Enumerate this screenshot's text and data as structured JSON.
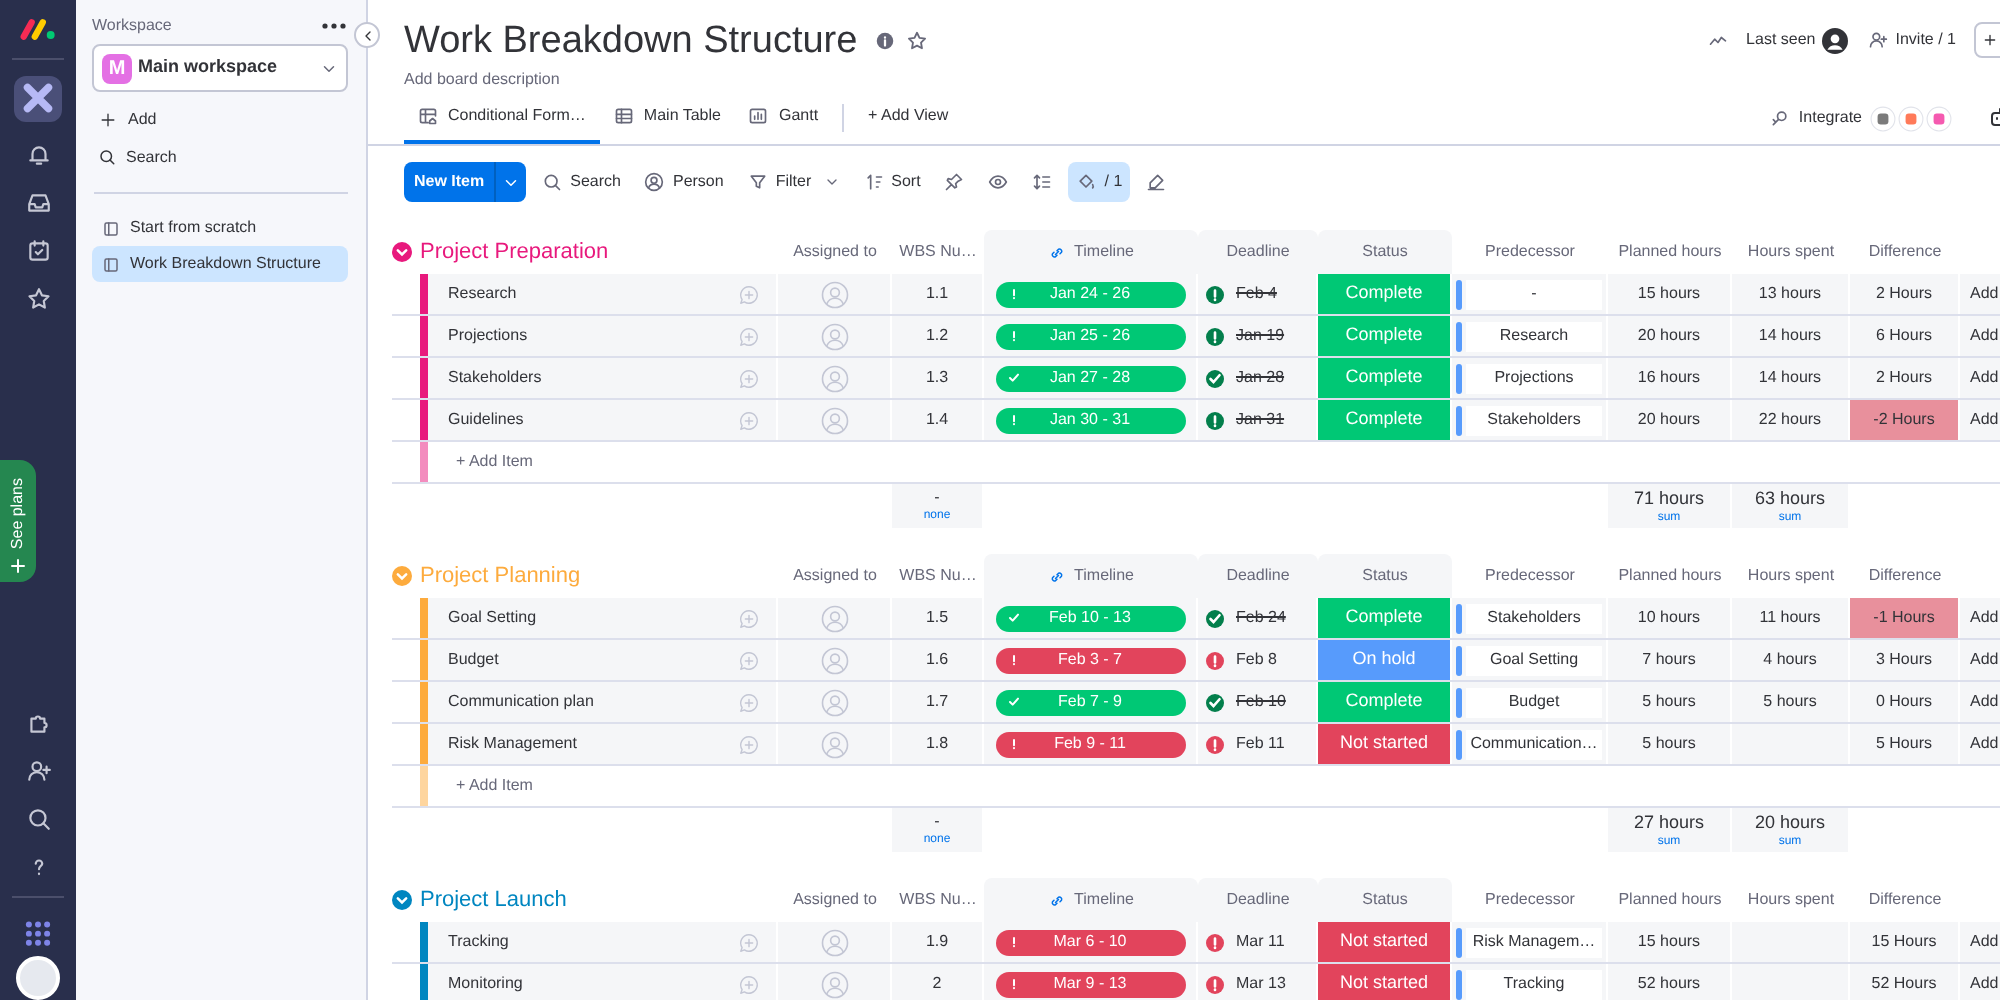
{
  "rail": {
    "see_plans": "See plans"
  },
  "sidebar": {
    "heading": "Workspace",
    "workspace": {
      "initial": "M",
      "name": "Main workspace"
    },
    "actions": [
      {
        "kind": "add",
        "label": "Add"
      },
      {
        "kind": "search",
        "label": "Search"
      }
    ],
    "boards": [
      {
        "label": "Start from scratch",
        "selected": false
      },
      {
        "label": "Work Breakdown Structure",
        "selected": true
      }
    ]
  },
  "board": {
    "title": "Work Breakdown Structure",
    "description": "Add board description",
    "last_seen": "Last seen",
    "invite": "Invite / 1",
    "tabs": [
      {
        "kind": "conditional",
        "label": "Conditional Form…",
        "selected": true
      },
      {
        "kind": "table",
        "label": "Main Table",
        "selected": false
      },
      {
        "kind": "gantt",
        "label": "Gantt",
        "selected": false
      }
    ],
    "add_view": "+ Add View",
    "integrate": "Integrate"
  },
  "toolbar": {
    "new_item": "New Item",
    "tools": [
      {
        "kind": "search",
        "label": "Search",
        "selected": false
      },
      {
        "kind": "person",
        "label": "Person",
        "selected": false
      },
      {
        "kind": "filter",
        "label": "Filter",
        "selected": false
      },
      {
        "kind": "sort",
        "label": "Sort",
        "selected": false
      },
      {
        "kind": "pin",
        "selected": false
      },
      {
        "kind": "hide",
        "selected": false
      },
      {
        "kind": "row_height",
        "selected": false
      },
      {
        "kind": "color",
        "label": "/ 1",
        "selected": true
      },
      {
        "kind": "brush",
        "selected": false
      }
    ]
  },
  "groups": [
    {
      "name": "Project Preparation",
      "color": "#e8197d",
      "columns": [
        {
          "kind": "people",
          "label": "Assigned to"
        },
        {
          "kind": "text",
          "label": "WBS Nu…"
        },
        {
          "kind": "timeline",
          "label": "Timeline"
        },
        {
          "kind": "date",
          "label": "Deadline"
        },
        {
          "kind": "status",
          "label": "Status"
        },
        {
          "kind": "text",
          "label": "Predecessor"
        },
        {
          "kind": "number",
          "label": "Planned hours"
        },
        {
          "kind": "number",
          "label": "Hours spent"
        },
        {
          "kind": "formula",
          "label": "Difference"
        }
      ],
      "rows": [
        {
          "name": "Research",
          "wbs": "1.1",
          "timeline": {
            "text": "Jan 24 - 26",
            "color": "#00c875",
            "on_track": false
          },
          "deadline": {
            "text": "Feb 4",
            "checked": false,
            "done": true
          },
          "status": {
            "text": "Complete",
            "color": "#00c875"
          },
          "predecessor": "-",
          "planned": "15 hours",
          "spent": "13 hours",
          "difference": {
            "text": "2 Hours",
            "flagged": false
          },
          "column_11": "Add"
        },
        {
          "name": "Projections",
          "wbs": "1.2",
          "timeline": {
            "text": "Jan 25 - 26",
            "color": "#00c875",
            "on_track": false
          },
          "deadline": {
            "text": "Jan 19",
            "checked": false,
            "done": true
          },
          "status": {
            "text": "Complete",
            "color": "#00c875"
          },
          "predecessor": "Research",
          "planned": "20 hours",
          "spent": "14 hours",
          "difference": {
            "text": "6 Hours",
            "flagged": false
          },
          "column_11": "Add"
        },
        {
          "name": "Stakeholders",
          "wbs": "1.3",
          "timeline": {
            "text": "Jan 27 - 28",
            "color": "#00c875",
            "on_track": true
          },
          "deadline": {
            "text": "Jan 28",
            "checked": true,
            "done": true
          },
          "status": {
            "text": "Complete",
            "color": "#00c875"
          },
          "predecessor": "Projections",
          "planned": "16 hours",
          "spent": "14 hours",
          "difference": {
            "text": "2 Hours",
            "flagged": false
          },
          "column_11": "Add"
        },
        {
          "name": "Guidelines",
          "wbs": "1.4",
          "timeline": {
            "text": "Jan 30 - 31",
            "color": "#00c875",
            "on_track": false
          },
          "deadline": {
            "text": "Jan 31",
            "checked": false,
            "done": true
          },
          "status": {
            "text": "Complete",
            "color": "#00c875"
          },
          "predecessor": "Stakeholders",
          "planned": "20 hours",
          "spent": "22 hours",
          "difference": {
            "text": "-2 Hours",
            "flagged": true
          },
          "column_11": "Add"
        }
      ],
      "add_item": "+ Add Item",
      "summary": {
        "wbs": {
          "value": "-",
          "label": "none"
        },
        "planned": {
          "value": "71 hours",
          "label": "sum"
        },
        "spent": {
          "value": "63 hours",
          "label": "sum"
        }
      }
    },
    {
      "name": "Project Planning",
      "color": "#fdab3d",
      "columns": [
        {
          "kind": "people",
          "label": "Assigned to"
        },
        {
          "kind": "text",
          "label": "WBS Nu…"
        },
        {
          "kind": "timeline",
          "label": "Timeline"
        },
        {
          "kind": "date",
          "label": "Deadline"
        },
        {
          "kind": "status",
          "label": "Status"
        },
        {
          "kind": "text",
          "label": "Predecessor"
        },
        {
          "kind": "number",
          "label": "Planned hours"
        },
        {
          "kind": "number",
          "label": "Hours spent"
        },
        {
          "kind": "formula",
          "label": "Difference"
        }
      ],
      "rows": [
        {
          "name": "Goal Setting",
          "wbs": "1.5",
          "timeline": {
            "text": "Feb 10 - 13",
            "color": "#00c875",
            "on_track": true
          },
          "deadline": {
            "text": "Feb 24",
            "checked": true,
            "done": true
          },
          "status": {
            "text": "Complete",
            "color": "#00c875"
          },
          "predecessor": "Stakeholders",
          "planned": "10 hours",
          "spent": "11 hours",
          "difference": {
            "text": "-1 Hours",
            "flagged": true
          },
          "column_11": "Add"
        },
        {
          "name": "Budget",
          "wbs": "1.6",
          "timeline": {
            "text": "Feb 3 - 7",
            "color": "#e2445c",
            "on_track": false
          },
          "deadline": {
            "text": "Feb 8",
            "checked": false,
            "done": false
          },
          "status": {
            "text": "On hold",
            "color": "#579bfc"
          },
          "predecessor": "Goal Setting",
          "planned": "7 hours",
          "spent": "4 hours",
          "difference": {
            "text": "3 Hours",
            "flagged": false
          },
          "column_11": "Add"
        },
        {
          "name": "Communication plan",
          "wbs": "1.7",
          "timeline": {
            "text": "Feb 7 - 9",
            "color": "#00c875",
            "on_track": true
          },
          "deadline": {
            "text": "Feb 10",
            "checked": true,
            "done": true
          },
          "status": {
            "text": "Complete",
            "color": "#00c875"
          },
          "predecessor": "Budget",
          "planned": "5 hours",
          "spent": "5 hours",
          "difference": {
            "text": "0 Hours",
            "flagged": false
          },
          "column_11": "Add"
        },
        {
          "name": "Risk Management",
          "wbs": "1.8",
          "timeline": {
            "text": "Feb 9 - 11",
            "color": "#e2445c",
            "on_track": false
          },
          "deadline": {
            "text": "Feb 11",
            "checked": false,
            "done": false
          },
          "status": {
            "text": "Not started",
            "color": "#e2445c"
          },
          "predecessor": "Communication…",
          "planned": "5 hours",
          "difference": {
            "text": "5 Hours",
            "flagged": false
          },
          "column_11": "Add"
        }
      ],
      "add_item": "+ Add Item",
      "summary": {
        "wbs": {
          "value": "-",
          "label": "none"
        },
        "planned": {
          "value": "27 hours",
          "label": "sum"
        },
        "spent": {
          "value": "20 hours",
          "label": "sum"
        }
      }
    },
    {
      "name": "Project Launch",
      "color": "#0086c0",
      "columns": [
        {
          "kind": "people",
          "label": "Assigned to"
        },
        {
          "kind": "text",
          "label": "WBS Nu…"
        },
        {
          "kind": "timeline",
          "label": "Timeline"
        },
        {
          "kind": "date",
          "label": "Deadline"
        },
        {
          "kind": "status",
          "label": "Status"
        },
        {
          "kind": "text",
          "label": "Predecessor"
        },
        {
          "kind": "number",
          "label": "Planned hours"
        },
        {
          "kind": "number",
          "label": "Hours spent"
        },
        {
          "kind": "formula",
          "label": "Difference"
        }
      ],
      "rows": [
        {
          "name": "Tracking",
          "wbs": "1.9",
          "timeline": {
            "text": "Mar 6 - 10",
            "color": "#e2445c",
            "on_track": false
          },
          "deadline": {
            "text": "Mar 11",
            "checked": false,
            "done": false
          },
          "status": {
            "text": "Not started",
            "color": "#e2445c"
          },
          "predecessor": "Risk Managem…",
          "planned": "15 hours",
          "difference": {
            "text": "15 Hours",
            "flagged": false
          },
          "column_11": "Add"
        },
        {
          "name": "Monitoring",
          "wbs": "2",
          "timeline": {
            "text": "Mar 9 - 13",
            "color": "#e2445c",
            "on_track": false
          },
          "deadline": {
            "text": "Mar 13",
            "checked": false,
            "done": false
          },
          "status": {
            "text": "Not started",
            "color": "#e2445c"
          },
          "predecessor": "Tracking",
          "planned": "52 hours",
          "difference": {
            "text": "52 Hours",
            "flagged": false
          },
          "column_11": "Add"
        }
      ]
    }
  ]
}
